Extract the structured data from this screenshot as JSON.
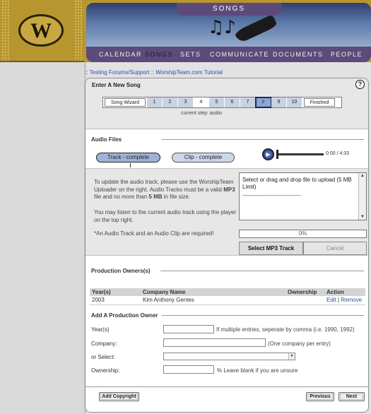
{
  "header": {
    "section_title": "SONGS",
    "nav": [
      "CALENDAR",
      "SONGS",
      "SETS",
      "COMMUNICATE",
      "DOCUMENTS",
      "PEOPLE"
    ],
    "active_nav": "SONGS",
    "logo_letter": "W"
  },
  "breadcrumb": {
    "sep": "::",
    "link1": "Testing Forums/Support",
    "link2": "WorshipTeam.com Tutorial"
  },
  "panel": {
    "title": "Enter A New Song",
    "help": "?"
  },
  "wizard": {
    "steps": [
      "Song Wizard",
      "1",
      "2",
      "3",
      "4",
      "5",
      "6",
      "7",
      "8",
      "9",
      "10",
      "Finished"
    ],
    "current_step_label": "current step: audio"
  },
  "audio": {
    "section_title": "Audio Files",
    "tab_track": "Track - complete",
    "tab_clip": "Clip - complete",
    "player_time": "0:00 / 4:33",
    "info_1_pre": "To update the audio track, please use the WorshipTeam Uploader on the right. Audio Tracks must be a valid ",
    "info_1_bold": "MP3",
    "info_1_mid": " file and no more than ",
    "info_1_bold2": "5 MB",
    "info_1_post": " in file size.",
    "info_2": "You may listen to the current audio track using the player on the top right.",
    "info_3": "*An Audio Track and an Audio Clip are required!",
    "upload_message": "Select or drag and drop file to upload (5 MB Limit)",
    "upload_dashes": "---------------------------------------------",
    "progress": "0%",
    "select_button": "Select MP3 Track",
    "cancel_button": "Cancel"
  },
  "owners": {
    "section_title": "Production Owners(s)",
    "columns": [
      "Year(s)",
      "Company Name",
      "Ownership",
      "Action"
    ],
    "rows": [
      {
        "year": "2003",
        "company": "Kim Anthony Gentes",
        "ownership": "",
        "edit": "Edit",
        "sep": "|",
        "remove": "Remove"
      }
    ]
  },
  "add_owner": {
    "section_title": "Add A Production Owner",
    "year_label": "Year(s)",
    "year_hint": "If multiple entries, seperate by comma (i.e. 1990, 1992)",
    "company_label": "Company:",
    "company_hint": "(One company per entry)",
    "select_label": "or Select:",
    "ownership_label": "Ownership:",
    "ownership_hint": "% Leave blank if you are unsure"
  },
  "footer": {
    "add_copyright": "Add Copyright",
    "previous": "Previous",
    "next": "Next"
  }
}
